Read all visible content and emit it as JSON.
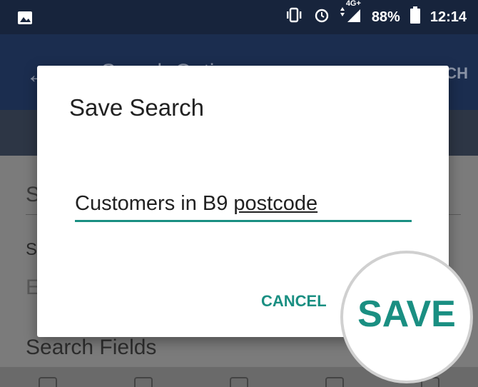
{
  "status_bar": {
    "battery_percent": "88%",
    "time": "12:14",
    "network_type": "4G+",
    "icons": [
      "image-icon",
      "vibrate-icon",
      "alarm-icon",
      "data-arrows-icon",
      "signal-icon",
      "battery-icon"
    ]
  },
  "app_bar": {
    "title": "Search Options",
    "action_label": "SEARCH"
  },
  "background": {
    "row1_label": "S",
    "row2_label": "S",
    "row3_label": "E",
    "search_fields_label": "Search Fields"
  },
  "dialog": {
    "title": "Save Search",
    "input_value_prefix": "Customers in B9",
    "input_value_last_word": "postcode",
    "cancel_label": "CANCEL",
    "save_label": "SAVE"
  },
  "colors": {
    "accent": "#1a8f82",
    "app_bar": "#1b2d4f",
    "status_bar": "#17243c"
  }
}
